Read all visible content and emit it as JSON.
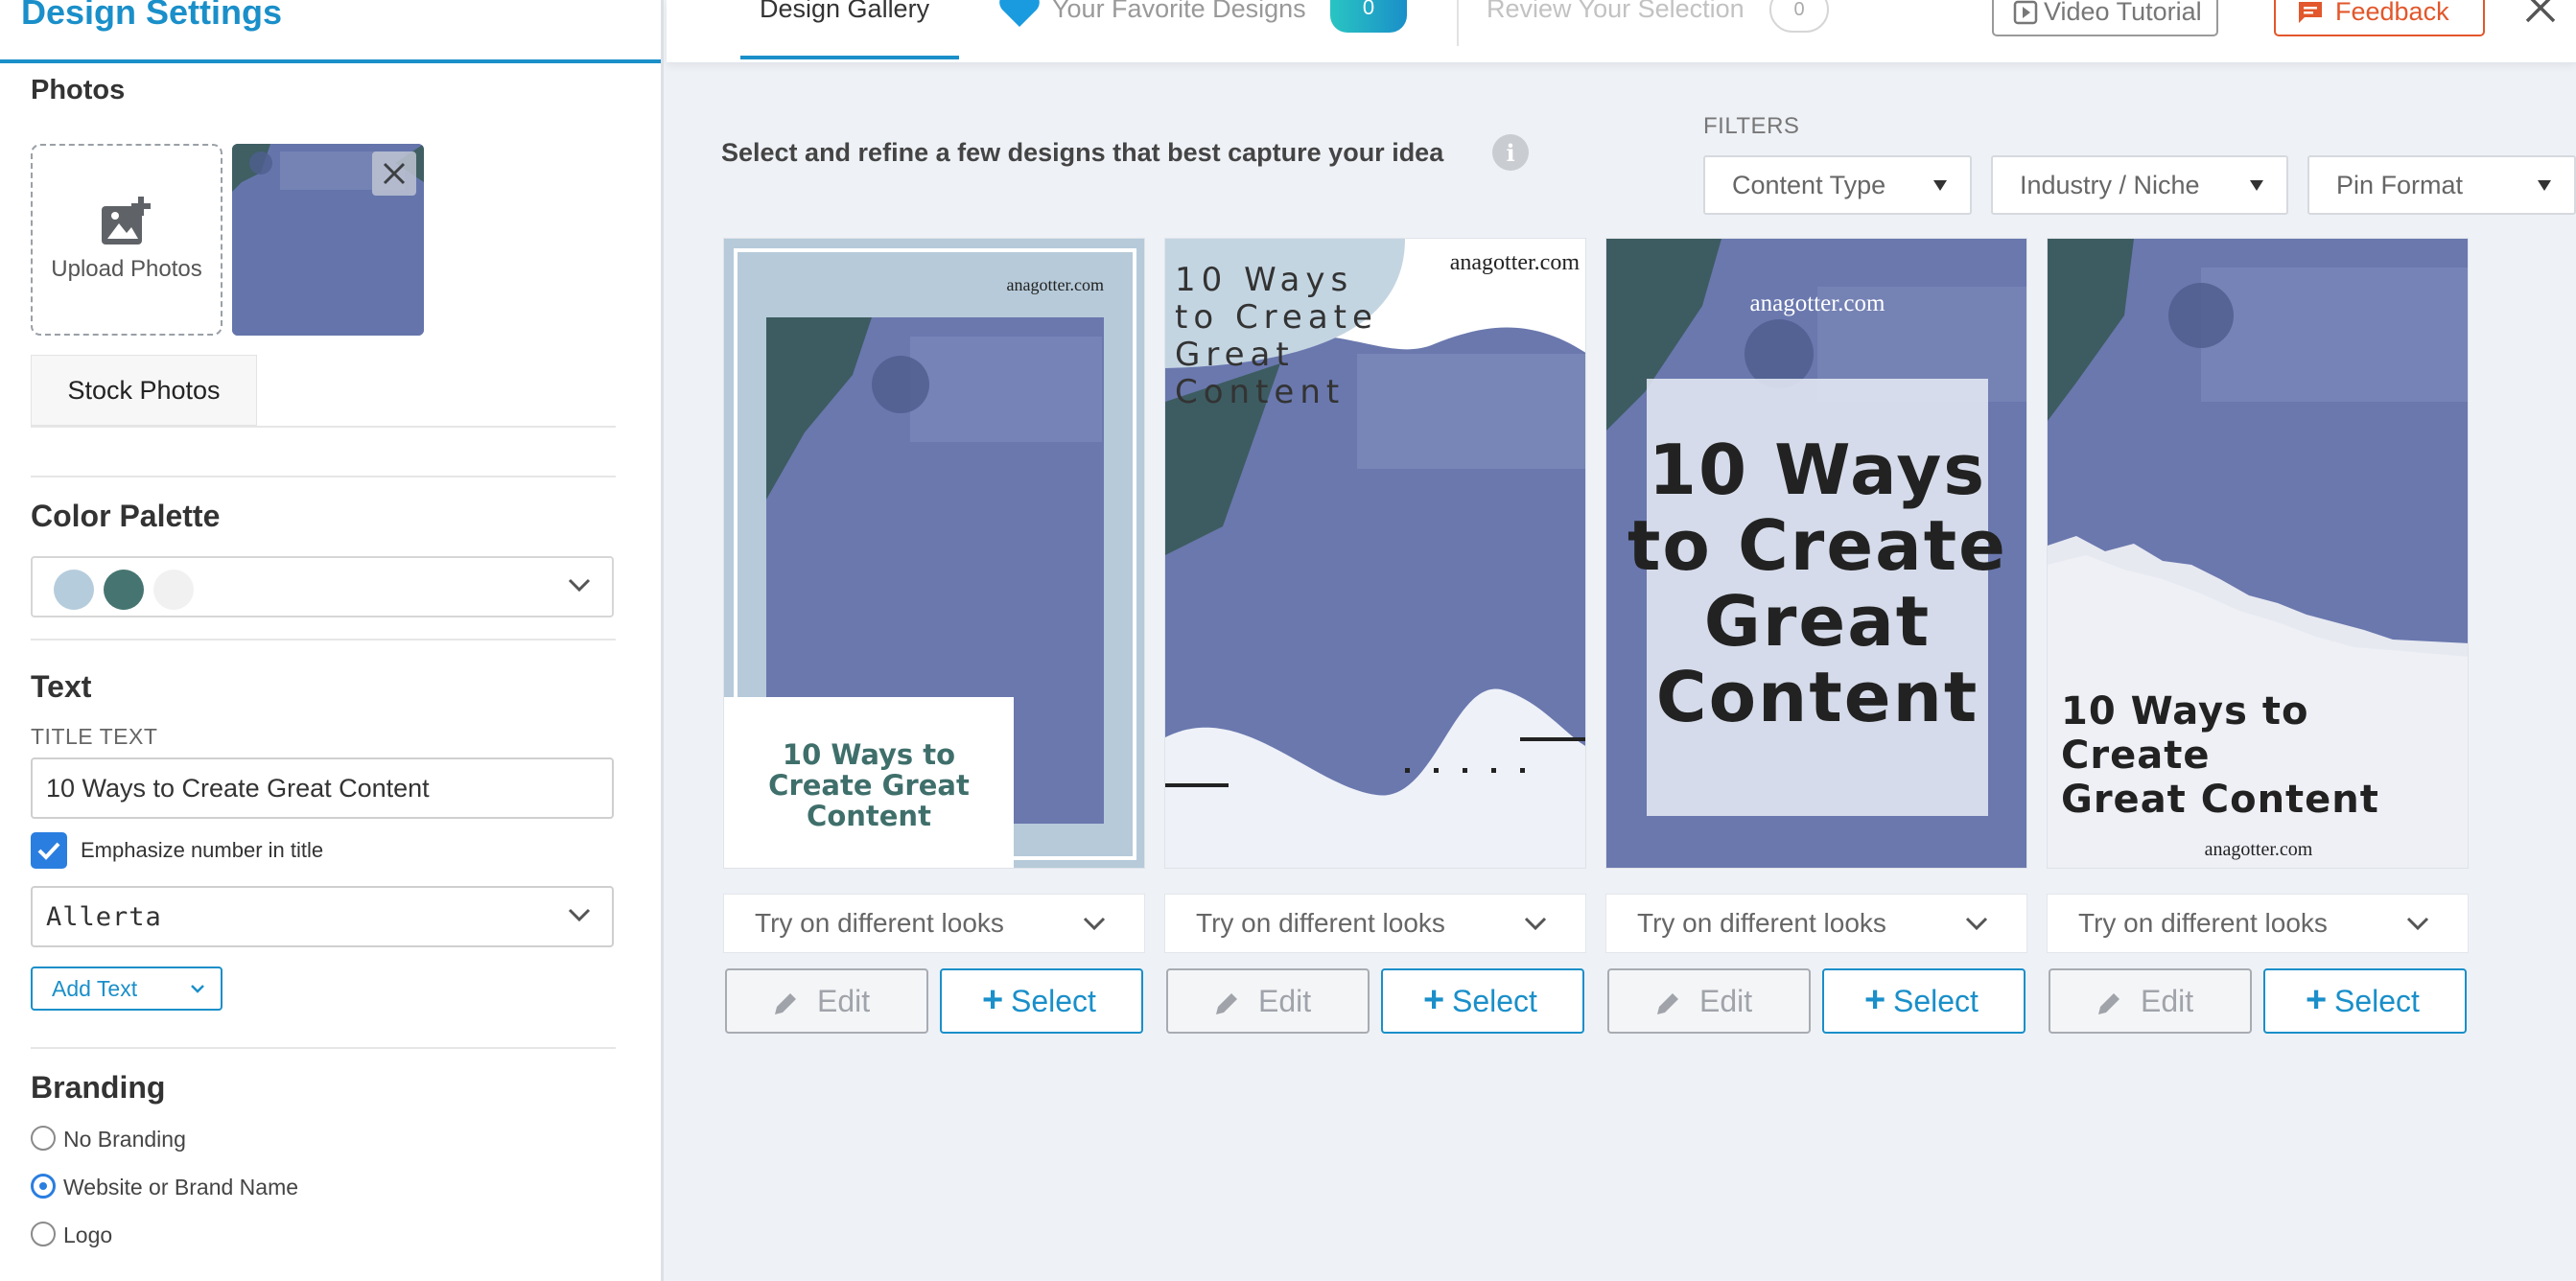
{
  "sidebar": {
    "title": "Design Settings",
    "photos": {
      "title": "Photos",
      "upload_label": "Upload Photos",
      "stock_label": "Stock Photos"
    },
    "palette": {
      "title": "Color Palette",
      "swatches": [
        "#b5ccdc",
        "#467571",
        "#f1f1f1"
      ]
    },
    "text": {
      "title": "Text",
      "title_text_label": "TITLE TEXT",
      "title_text_value": "10 Ways to Create Great Content",
      "emphasize_label": "Emphasize number in title",
      "emphasize_checked": true,
      "font_value": "Allerta",
      "add_text_label": "Add Text"
    },
    "branding": {
      "title": "Branding",
      "options": [
        "No Branding",
        "Website or Brand Name",
        "Logo"
      ],
      "selected": "Website or Brand Name"
    }
  },
  "nav": {
    "tabs": {
      "gallery": "Design Gallery",
      "favorites": "Your Favorite Designs",
      "favorites_count": "0",
      "review": "Review Your Selection",
      "review_count": "0"
    },
    "video_tutorial": "Video Tutorial",
    "feedback": "Feedback"
  },
  "main": {
    "intro": "Select and refine a few designs that best capture your idea",
    "filters_label": "FILTERS",
    "filters": [
      "Content Type",
      "Industry / Niche",
      "Pin Format"
    ],
    "designs": [
      {
        "brand": "anagotter.com",
        "title_a": "10 Ways to",
        "title_b": "Create Great",
        "title_c": "Content"
      },
      {
        "brand": "anagotter.com",
        "title_a": "10 Ways",
        "title_b": "to Create",
        "title_c": "Great",
        "title_d": "Content"
      },
      {
        "brand": "anagotter.com",
        "title_a": "10 Ways",
        "title_b": "to Create",
        "title_c": "Great",
        "title_d": "Content"
      },
      {
        "brand": "anagotter.com",
        "title_a": "10 Ways to Create",
        "title_b": "Great Content"
      }
    ],
    "looks_label": "Try on different looks",
    "edit_label": "Edit",
    "select_label": "Select",
    "select_icon": "+"
  },
  "colors": {
    "accent": "#1a8fc9",
    "feedback": "#e2572b",
    "checkbox": "#2a7ee0",
    "photo_tint": "#6a78ae"
  }
}
